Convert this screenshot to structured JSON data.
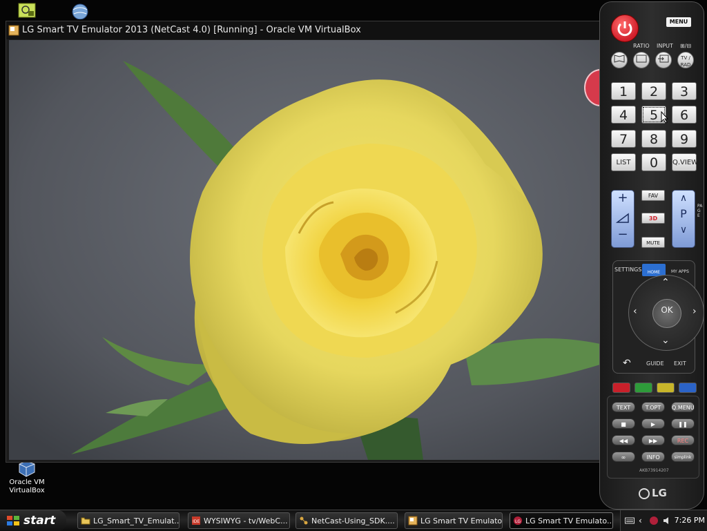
{
  "desktop": {
    "icons": [
      {
        "name": "Oracle VM VirtualBox",
        "line1": "Oracle VM",
        "line2": "VirtualBox"
      }
    ]
  },
  "window": {
    "title": "LG Smart TV Emulator 2013 (NetCast 4.0) [Running] - Oracle VM VirtualBox",
    "content_image": "yellow-rose-photo"
  },
  "remote": {
    "menu": "MENU",
    "top_labels": [
      "RATIO",
      "INPUT",
      "⊞/⊟"
    ],
    "tv_rad": "TV / RAD",
    "keys": [
      "1",
      "2",
      "3",
      "4",
      "5",
      "6",
      "7",
      "8",
      "9",
      "LIST",
      "0",
      "Q.VIEW"
    ],
    "focused_key": "5",
    "fav": "FAV",
    "three_d": "3D",
    "mute": "MUTE",
    "page": "PAGE",
    "settings": "SETTINGS",
    "home": "HOME",
    "my_apps": "MY APPS",
    "ok": "OK",
    "guide": "GUIDE",
    "exit": "EXIT",
    "color_colors": [
      "#c8202a",
      "#2e9b3a",
      "#c7b52a",
      "#2b63c7"
    ],
    "lower_keys": [
      "TEXT",
      "T.OPT",
      "Q.MENU",
      "■",
      "▶",
      "❚❚",
      "◀◀",
      "▶▶",
      "REC",
      "∞",
      "INFO",
      "simplink"
    ],
    "model": "AKB73914207",
    "brand": "LG",
    "vol_plus": "+",
    "vol_minus": "−",
    "p_label": "P"
  },
  "taskbar": {
    "start": "start",
    "tasks": [
      {
        "label": "LG_Smart_TV_Emulat...",
        "icon": "folder-icon"
      },
      {
        "label": "WYSIWYG - tv/WebC...",
        "icon": "ide-icon"
      },
      {
        "label": "NetCast-Using_SDK....",
        "icon": "network-icon"
      },
      {
        "label": "LG Smart TV Emulato...",
        "icon": "virtualbox-icon"
      },
      {
        "label": "LG Smart TV Emulato...",
        "icon": "lg-icon",
        "active": true
      }
    ],
    "clock": "7:26 PM"
  }
}
